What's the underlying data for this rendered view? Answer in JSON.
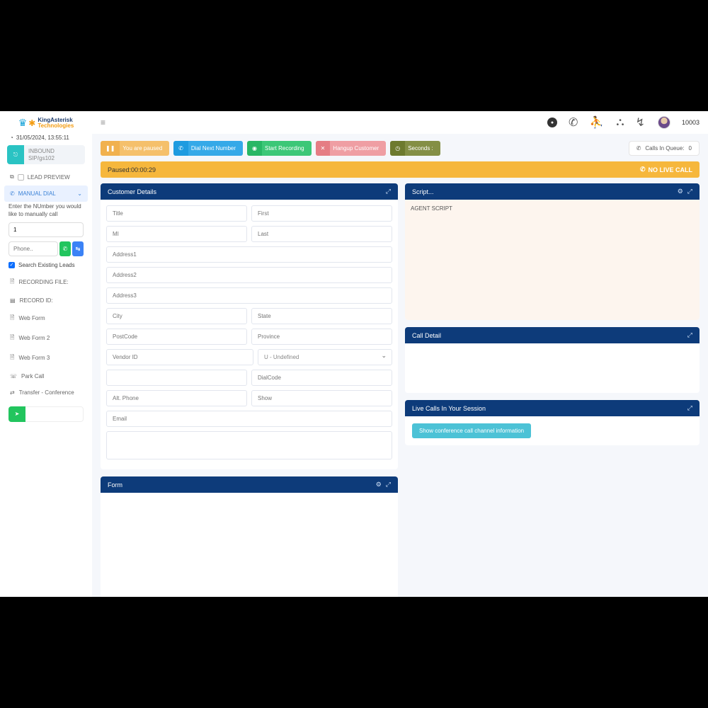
{
  "logo": {
    "line1": "KingAsterisk",
    "line2": "Technologies"
  },
  "datetime": "31/05/2024, 13:55:11",
  "status_btn": {
    "line1": "INBOUND",
    "line2": "SIP/gs102"
  },
  "sidebar": {
    "lead_preview": "LEAD PREVIEW",
    "manual_dial": "MANUAL DIAL",
    "manual_help": "Enter the NUmber you would like to manually call",
    "num_value": "1",
    "phone_placeholder": "Phone..",
    "search_existing": "Search Existing Leads",
    "items": [
      {
        "label": "RECORDING FILE:"
      },
      {
        "label": "RECORD ID:"
      },
      {
        "label": "Web Form"
      },
      {
        "label": "Web Form 2"
      },
      {
        "label": "Web Form 3"
      },
      {
        "label": "Park Call"
      },
      {
        "label": "Transfer - Conference"
      }
    ]
  },
  "topbar": {
    "user_id": "10003"
  },
  "actions": {
    "paused": "You are paused",
    "dial_next": "Dial Next Number",
    "start_rec": "Start Recording",
    "hangup": "Hangup Customer",
    "seconds": "Seconds :"
  },
  "queue": {
    "label": "Calls In Queue:",
    "count": "0"
  },
  "status": {
    "left": "Paused:00:00:29",
    "right": "NO LIVE CALL"
  },
  "panels": {
    "customer": {
      "title": "Customer Details",
      "ph": {
        "title": "Title",
        "first": "First",
        "mi": "MI",
        "last": "Last",
        "addr1": "Address1",
        "addr2": "Address2",
        "addr3": "Address3",
        "city": "City",
        "state": "State",
        "postcode": "PostCode",
        "province": "Province",
        "vendor": "Vendor ID",
        "gender": "U - Undefined",
        "blank": "",
        "dialcode": "DialCode",
        "altphone": "Alt. Phone",
        "show": "Show",
        "email": "Email"
      }
    },
    "form": {
      "title": "Form"
    },
    "script": {
      "title": "Script...",
      "body": "AGENT SCRIPT"
    },
    "calldetail": {
      "title": "Call Detail"
    },
    "livecalls": {
      "title": "Live Calls In Your Session",
      "button": "Show conference call channel information"
    }
  }
}
